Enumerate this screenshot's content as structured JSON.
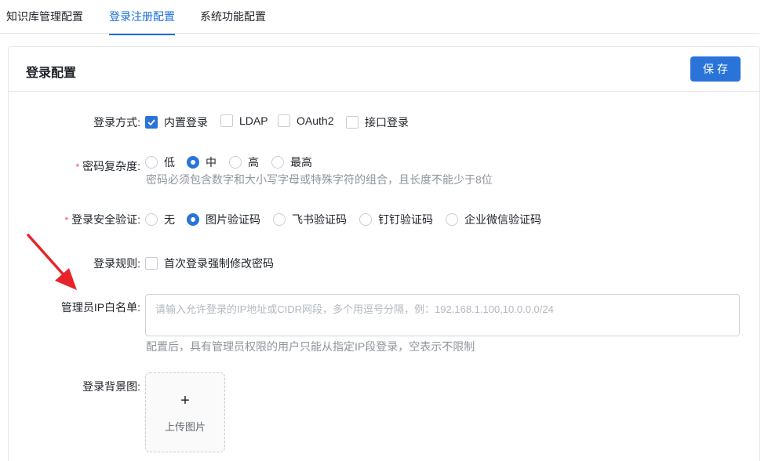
{
  "tabs": [
    {
      "label": "知识库管理配置"
    },
    {
      "label": "登录注册配置"
    },
    {
      "label": "系统功能配置"
    }
  ],
  "card": {
    "title": "登录配置",
    "save_label": "保存"
  },
  "login_method": {
    "label": "登录方式:",
    "options": [
      {
        "label": "内置登录",
        "checked": true
      },
      {
        "label": "LDAP",
        "checked": false
      },
      {
        "label": "OAuth2",
        "checked": false
      },
      {
        "label": "接口登录",
        "checked": false
      }
    ]
  },
  "password_complexity": {
    "label": "密码复杂度:",
    "required": "*",
    "options": [
      {
        "label": "低",
        "checked": false
      },
      {
        "label": "中",
        "checked": true
      },
      {
        "label": "高",
        "checked": false
      },
      {
        "label": "最高",
        "checked": false
      }
    ],
    "hint": "密码必须包含数字和大小写字母或特殊字符的组合，且长度不能少于8位"
  },
  "security_verification": {
    "label": "登录安全验证:",
    "required": "*",
    "options": [
      {
        "label": "无",
        "checked": false
      },
      {
        "label": "图片验证码",
        "checked": true
      },
      {
        "label": "飞书验证码",
        "checked": false
      },
      {
        "label": "钉钉验证码",
        "checked": false
      },
      {
        "label": "企业微信验证码",
        "checked": false
      }
    ]
  },
  "login_rules": {
    "label": "登录规则:",
    "options": [
      {
        "label": "首次登录强制修改密码",
        "checked": false
      }
    ]
  },
  "ip_whitelist": {
    "label": "管理员IP白名单:",
    "placeholder": "请输入允许登录的IP地址或CIDR网段，多个用逗号分隔，例：192.168.1.100,10.0.0.0/24",
    "value": "",
    "hint": "配置后，具有管理员权限的用户只能从指定IP段登录，空表示不限制"
  },
  "background": {
    "label": "登录背景图:",
    "upload_label": "上传图片",
    "upload_icon": "+"
  },
  "colors": {
    "accent": "#2a73d9",
    "required": "#e34d59",
    "annotation_arrow": "#e8242b"
  }
}
